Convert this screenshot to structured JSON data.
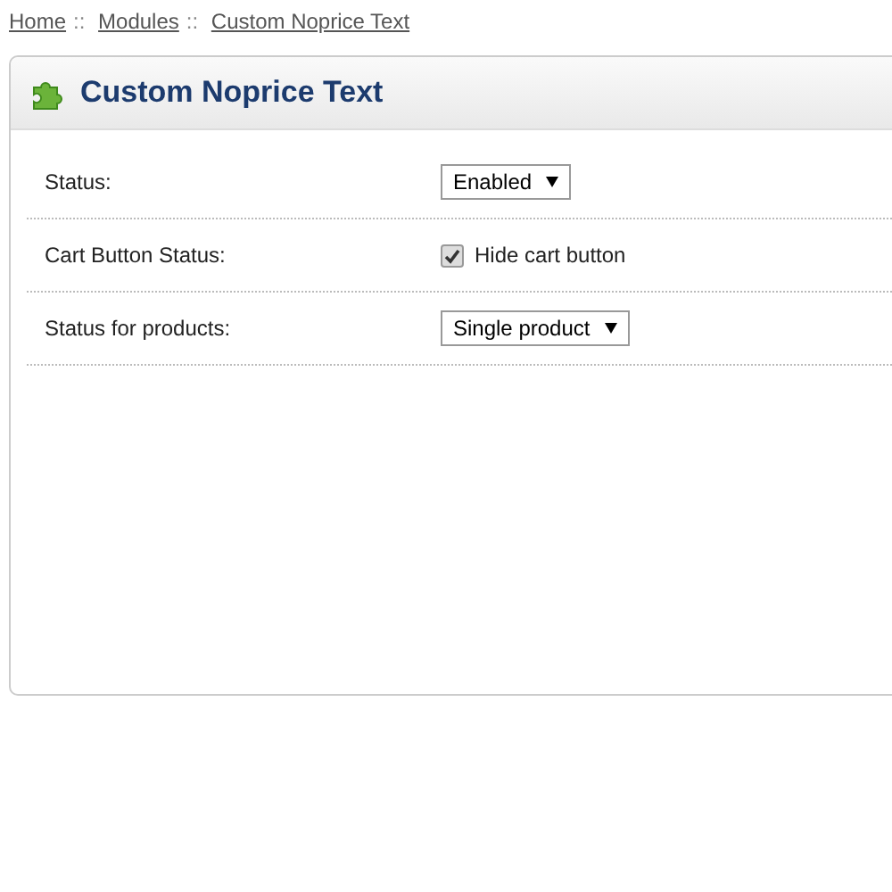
{
  "breadcrumb": {
    "links": [
      "Home",
      "Modules",
      "Custom Noprice Text"
    ],
    "separator": "::"
  },
  "panel": {
    "title": "Custom Noprice Text"
  },
  "rows": [
    {
      "kind": "select",
      "label": "Status:",
      "value": "Enabled"
    },
    {
      "kind": "checkbox",
      "label": "Cart Button Status:",
      "option": "Hide cart button",
      "checked": true
    },
    {
      "kind": "select",
      "label": "Status for products:",
      "value": "Single product"
    }
  ]
}
